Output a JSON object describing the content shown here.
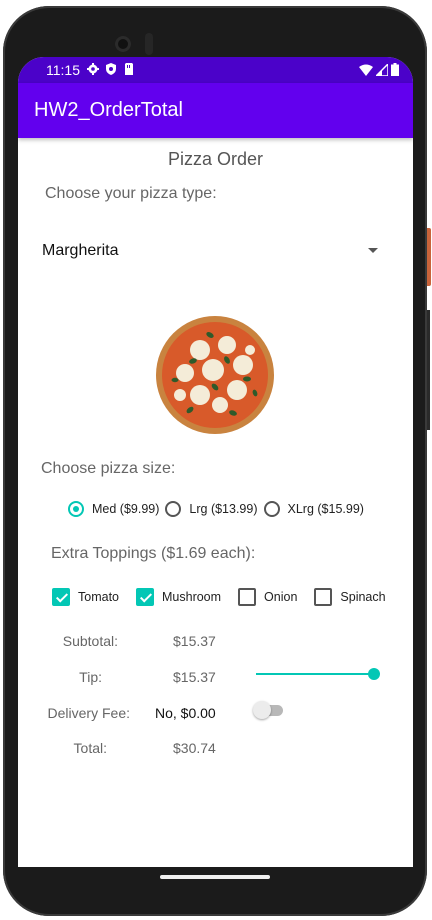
{
  "status": {
    "time": "11:15",
    "left_icons": [
      "gear-icon",
      "shield-icon",
      "sim-card-icon"
    ],
    "right_icons": [
      "wifi-icon",
      "cell-signal-icon",
      "battery-icon"
    ]
  },
  "appbar": {
    "title": "HW2_OrderTotal"
  },
  "main": {
    "heading": "Pizza Order",
    "choose_type_label": "Choose your pizza type:",
    "pizza_type_selected": "Margherita",
    "choose_size_label": "Choose pizza size:",
    "sizes": [
      {
        "label": "Med ($9.99)",
        "selected": true
      },
      {
        "label": "Lrg ($13.99)",
        "selected": false
      },
      {
        "label": "XLrg ($15.99)",
        "selected": false
      }
    ],
    "toppings_label": "Extra Toppings ($1.69 each):",
    "toppings": [
      {
        "label": "Tomato",
        "checked": true
      },
      {
        "label": "Mushroom",
        "checked": true
      },
      {
        "label": "Onion",
        "checked": false
      },
      {
        "label": "Spinach",
        "checked": false
      }
    ],
    "subtotal_label": "Subtotal:",
    "subtotal_value": "$15.37",
    "tip_label": "Tip:",
    "tip_value": "$15.37",
    "tip_slider_fraction": 1.0,
    "delivery_label": "Delivery Fee:",
    "delivery_value": "No, $0.00",
    "delivery_switch_on": false,
    "total_label": "Total:",
    "total_value": "$30.74"
  },
  "colors": {
    "accent": "#03c7b5",
    "appbar": "#6200ee",
    "statusbar": "#4b02c9"
  }
}
